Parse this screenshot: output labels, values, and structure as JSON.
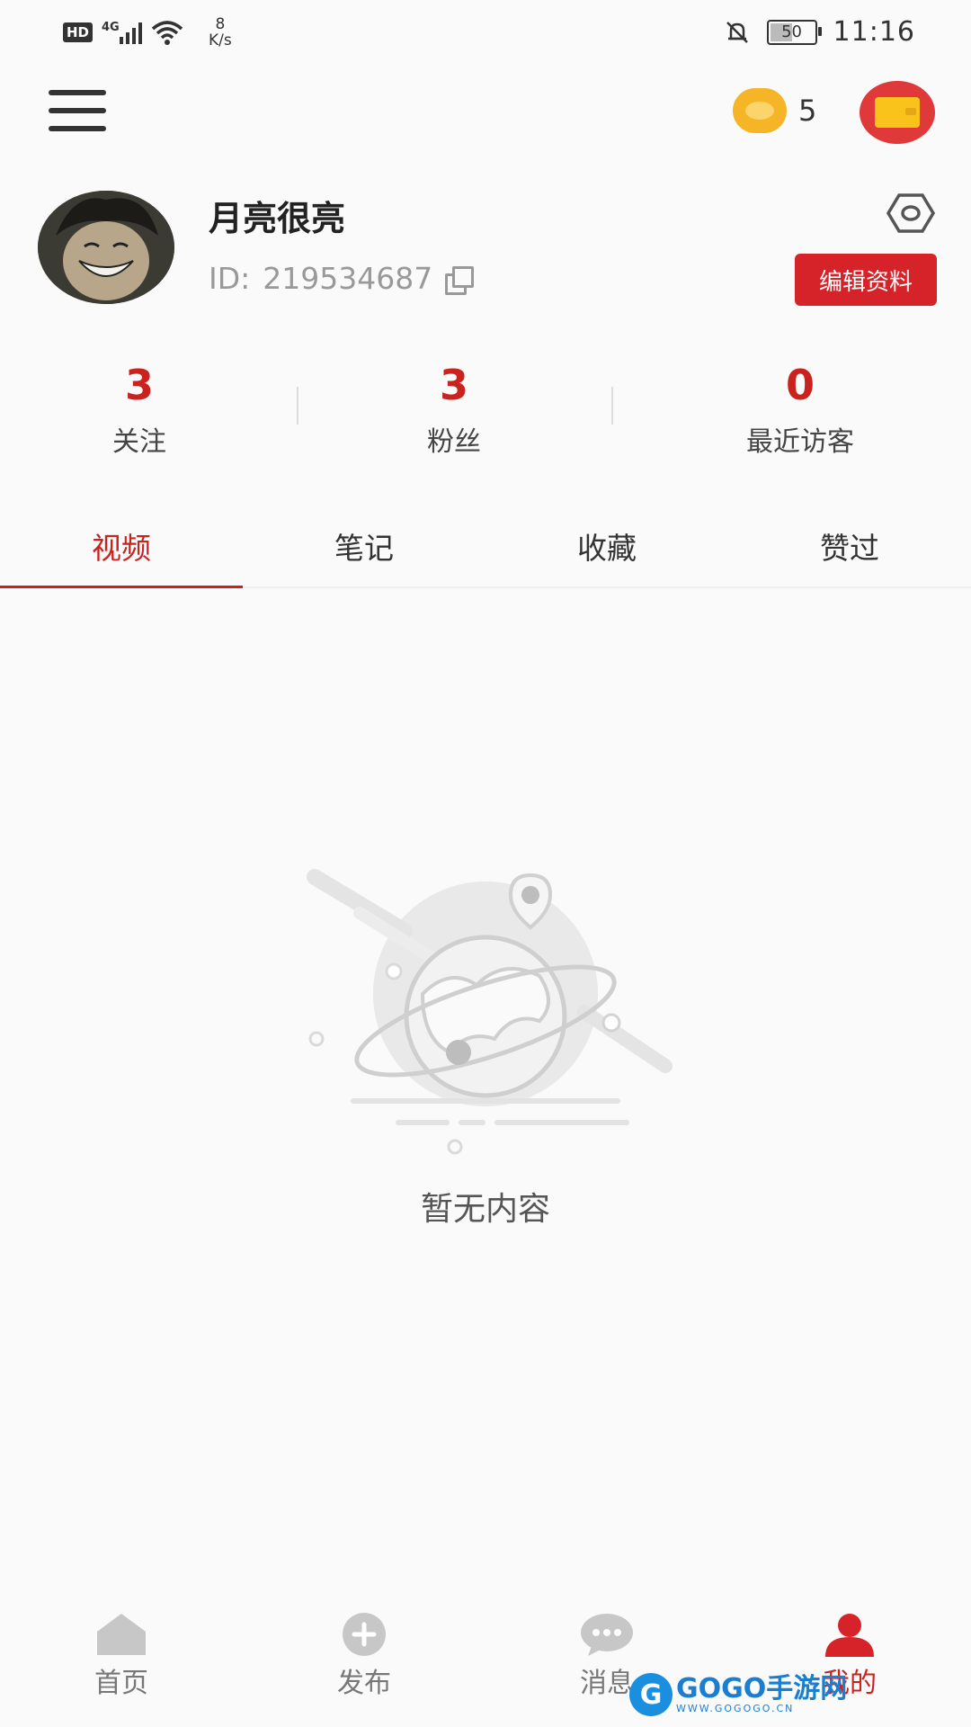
{
  "status_bar": {
    "hd": "HD",
    "network": "4G",
    "speed_value": "8",
    "speed_unit": "K/s",
    "battery": "50",
    "time": "11:16"
  },
  "header": {
    "coin_count": "5"
  },
  "profile": {
    "username": "月亮很亮",
    "id_label": "ID:",
    "id_value": "219534687",
    "edit_button": "编辑资料"
  },
  "stats": [
    {
      "value": "3",
      "label": "关注"
    },
    {
      "value": "3",
      "label": "粉丝"
    },
    {
      "value": "0",
      "label": "最近访客"
    }
  ],
  "tabs": [
    "视频",
    "笔记",
    "收藏",
    "赞过"
  ],
  "active_tab": 0,
  "empty_state": {
    "text": "暂无内容"
  },
  "bottom_nav": [
    {
      "label": "首页",
      "icon": "home-icon"
    },
    {
      "label": "发布",
      "icon": "plus-icon"
    },
    {
      "label": "消息",
      "icon": "chat-icon"
    },
    {
      "label": "我的",
      "icon": "user-icon"
    }
  ],
  "watermark": {
    "text": "GOGO手游网",
    "sub": "WWW.GOGOGO.CN"
  },
  "colors": {
    "accent": "#c9221f",
    "edit_button": "#d6232a",
    "coin": "#f6b427",
    "wallet": "#e0393a"
  }
}
